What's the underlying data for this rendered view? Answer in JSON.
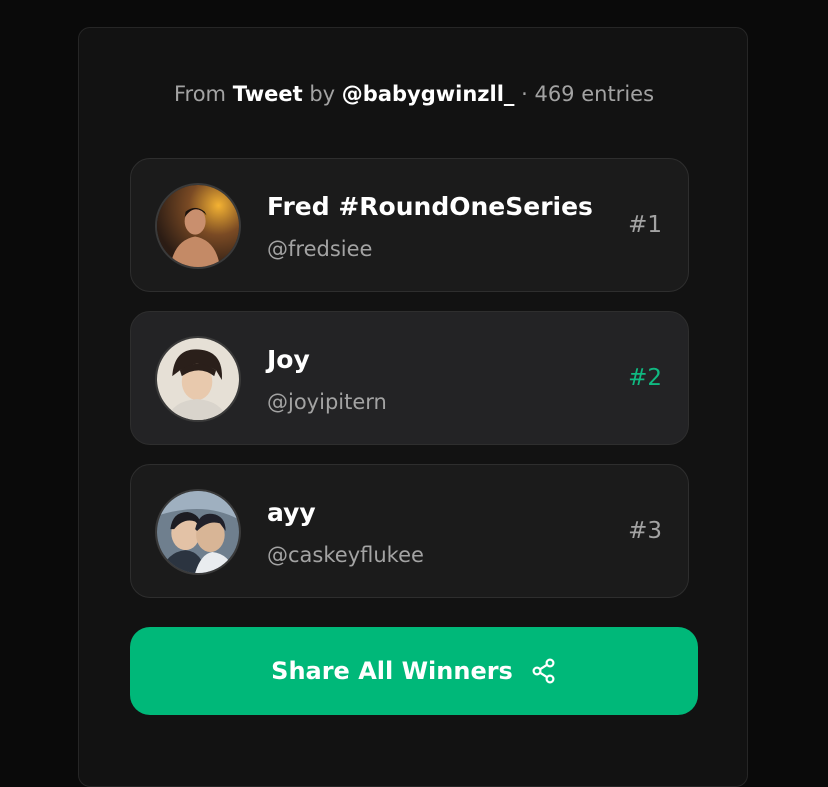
{
  "header": {
    "from": "From",
    "source": "Tweet",
    "by": "by",
    "author": "@babygwinzll_",
    "entries": "· 469 entries"
  },
  "winners": [
    {
      "name": "Fred #RoundOneSeries",
      "handle": "@fredsiee",
      "rank": "#1"
    },
    {
      "name": "Joy",
      "handle": "@joyipitern",
      "rank": "#2"
    },
    {
      "name": "ayy",
      "handle": "@caskeyflukee",
      "rank": "#3"
    }
  ],
  "share_button": {
    "label": "Share All Winners",
    "icon": "share-icon"
  },
  "colors": {
    "accent": "#00b879",
    "highlight_rank": "#10b981"
  }
}
